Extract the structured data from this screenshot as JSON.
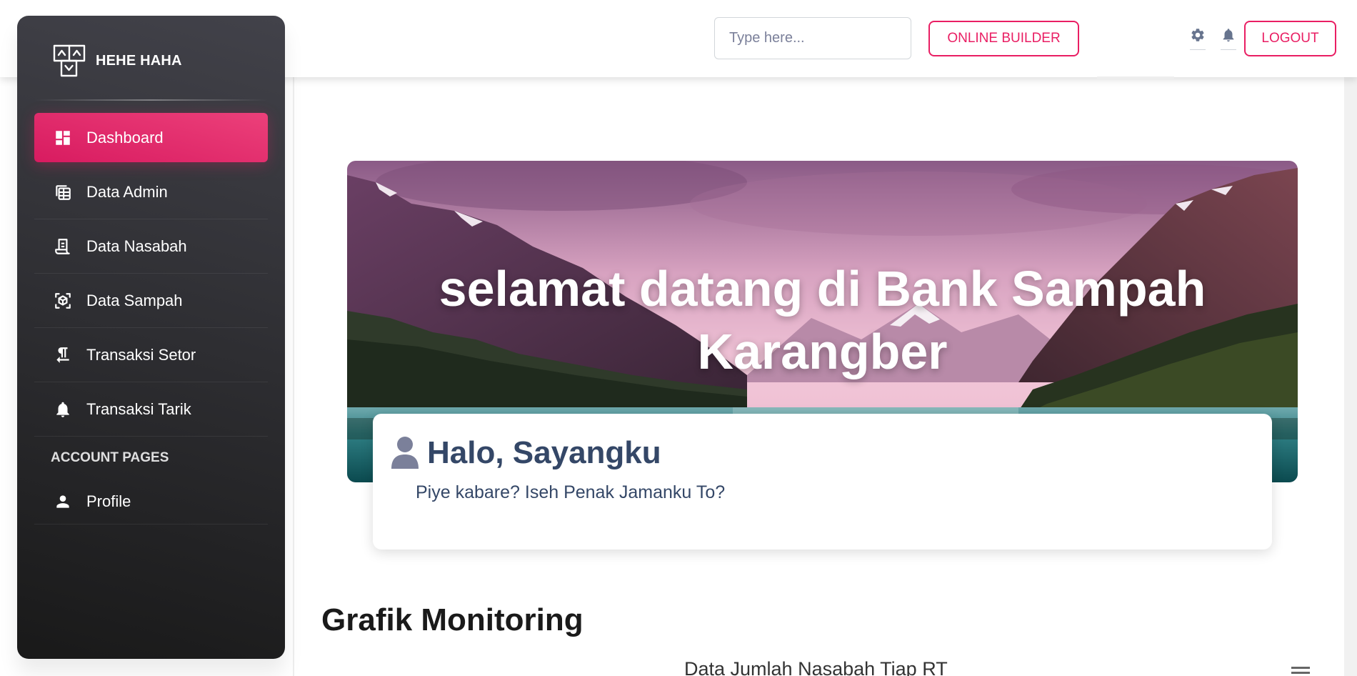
{
  "brand": {
    "name": "HEHE HAHA",
    "logo_icon": "box-arrows-logo"
  },
  "sidebar": {
    "items": [
      {
        "label": "Dashboard",
        "icon": "dashboard-icon",
        "active": true
      },
      {
        "label": "Data Admin",
        "icon": "table-icon"
      },
      {
        "label": "Data Nasabah",
        "icon": "receipt-icon"
      },
      {
        "label": "Data Sampah",
        "icon": "cube-icon"
      },
      {
        "label": "Transaksi Setor",
        "icon": "format-textdirection-icon"
      },
      {
        "label": "Transaksi Tarik",
        "icon": "notifications-icon"
      }
    ],
    "section_label": "ACCOUNT PAGES",
    "profile": {
      "label": "Profile",
      "icon": "person-icon"
    }
  },
  "topbar": {
    "search_placeholder": "Type here...",
    "builder_label": "ONLINE BUILDER",
    "logout_label": "LOGOUT",
    "icons": [
      "gear-icon",
      "bell-icon"
    ]
  },
  "hero": {
    "title": "selamat datang di Bank Sampah Karangber"
  },
  "welcome_card": {
    "title": "Halo, Sayangku",
    "subtitle": "Piye kabare? Iseh Penak Jamanku To?"
  },
  "section_title": "Grafik Monitoring",
  "chart": {
    "title": "Data Jumlah Nasabah Tiap RT"
  },
  "colors": {
    "accent": "#e91e63",
    "sidebar_dark": "#191919",
    "text_dark": "#344767"
  }
}
